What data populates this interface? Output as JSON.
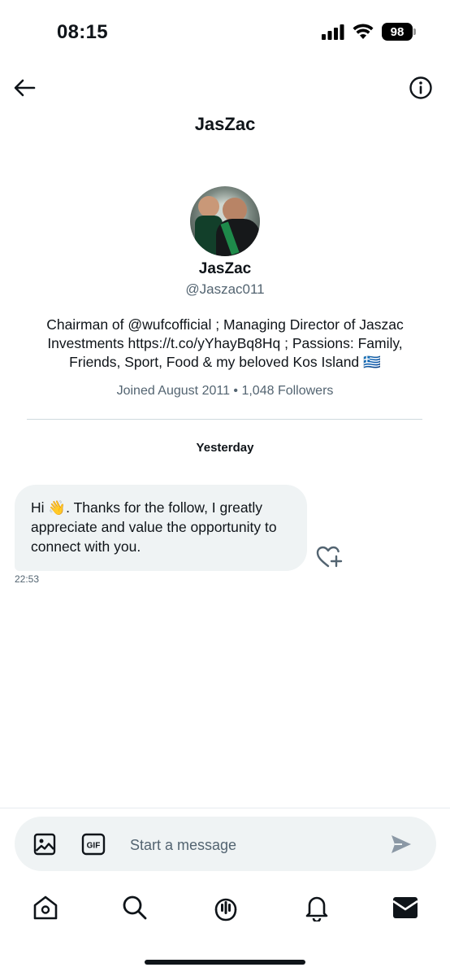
{
  "status_bar": {
    "time": "08:15",
    "battery": "98"
  },
  "header": {
    "title": "JasZac",
    "icons": [
      "back-arrow-icon",
      "info-icon"
    ]
  },
  "profile": {
    "name": "JasZac",
    "handle": "@Jaszac011",
    "bio": "Chairman of @wufcofficial ; Managing Director of Jaszac Investments https://t.co/yYhayBq8Hq ; Passions: Family, Friends, Sport, Food & my beloved Kos Island 🇬🇷",
    "meta": "Joined August 2011 • 1,048 Followers"
  },
  "conversation": {
    "date_separator": "Yesterday",
    "messages": [
      {
        "text": "Hi 👋. Thanks for the follow, I greatly appreciate and value the opportunity to connect with you.",
        "time": "22:53"
      }
    ]
  },
  "composer": {
    "placeholder": "Start a message",
    "gif_label": "GIF"
  },
  "tab_bar": {
    "items": [
      "home-icon",
      "search-icon",
      "spaces-icon",
      "notifications-icon",
      "messages-icon"
    ],
    "active": "messages-icon"
  },
  "colors": {
    "text": "#0f1419",
    "secondary": "#536471",
    "bubble": "#eff3f4",
    "divider": "#cfd9de"
  }
}
